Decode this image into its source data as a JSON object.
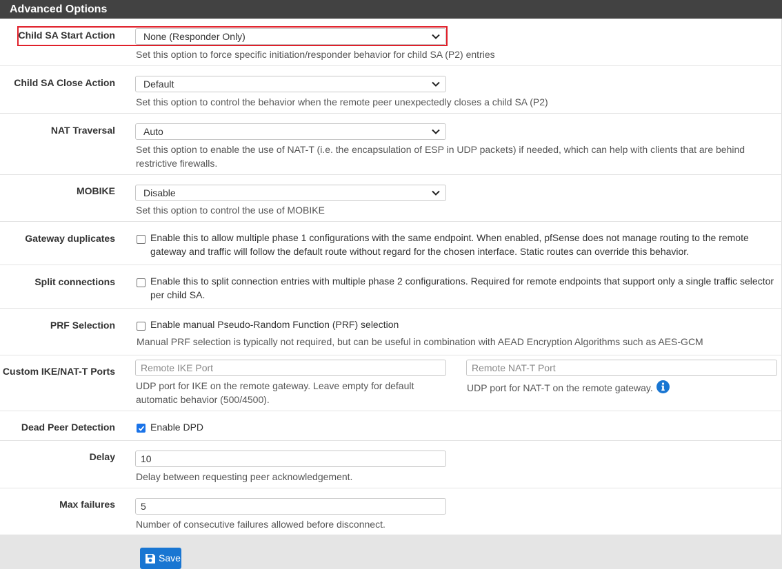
{
  "panel": {
    "title": "Advanced Options"
  },
  "child_sa_start": {
    "label": "Child SA Start Action",
    "value": "None (Responder Only)",
    "help": "Set this option to force specific initiation/responder behavior for child SA (P2) entries"
  },
  "child_sa_close": {
    "label": "Child SA Close Action",
    "value": "Default",
    "help": "Set this option to control the behavior when the remote peer unexpectedly closes a child SA (P2)"
  },
  "nat_traversal": {
    "label": "NAT Traversal",
    "value": "Auto",
    "help_line1": "Set this option to enable the use of NAT-T (i.e. the encapsulation of ESP in UDP packets) if needed, which can help with clients that are behind",
    "help_line2": "restrictive firewalls."
  },
  "mobike": {
    "label": "MOBIKE",
    "value": "Disable",
    "help": "Set this option to control the use of MOBIKE"
  },
  "gateway_duplicates": {
    "label": "Gateway duplicates",
    "checked": false,
    "text_line1": "Enable this to allow multiple phase 1 configurations with the same endpoint. When enabled, pfSense does not manage routing to the remote",
    "text_line2": "gateway and traffic will follow the default route without regard for the chosen interface. Static routes can override this behavior."
  },
  "split_connections": {
    "label": "Split connections",
    "checked": false,
    "text_line1": "Enable this to split connection entries with multiple phase 2 configurations. Required for remote endpoints that support only a single traffic selector",
    "text_line2": "per child SA."
  },
  "prf_selection": {
    "label": "PRF Selection",
    "checked": false,
    "text": "Enable manual Pseudo-Random Function (PRF) selection",
    "help": "Manual PRF selection is typically not required, but can be useful in combination with AEAD Encryption Algorithms such as AES-GCM"
  },
  "custom_ports": {
    "label": "Custom IKE/NAT-T Ports",
    "ike_placeholder": "Remote IKE Port",
    "ike_help_line1": "UDP port for IKE on the remote gateway. Leave empty for default",
    "ike_help_line2": "automatic behavior (500/4500).",
    "natt_placeholder": "Remote NAT-T Port",
    "natt_help": "UDP port for NAT-T on the remote gateway."
  },
  "dpd": {
    "label": "Dead Peer Detection",
    "checked": true,
    "text": "Enable DPD"
  },
  "delay": {
    "label": "Delay",
    "value": "10",
    "help": "Delay between requesting peer acknowledgement."
  },
  "max_failures": {
    "label": "Max failures",
    "value": "5",
    "help": "Number of consecutive failures allowed before disconnect."
  },
  "save_button": {
    "label": "Save"
  },
  "icons": {
    "chevron": "chevron-down-icon",
    "info": "info-icon",
    "save": "floppy-disk-icon",
    "check": "checkmark-icon"
  },
  "colors": {
    "heading_bg": "#424242",
    "highlight": "#e0202a",
    "primary": "#1976d2"
  }
}
